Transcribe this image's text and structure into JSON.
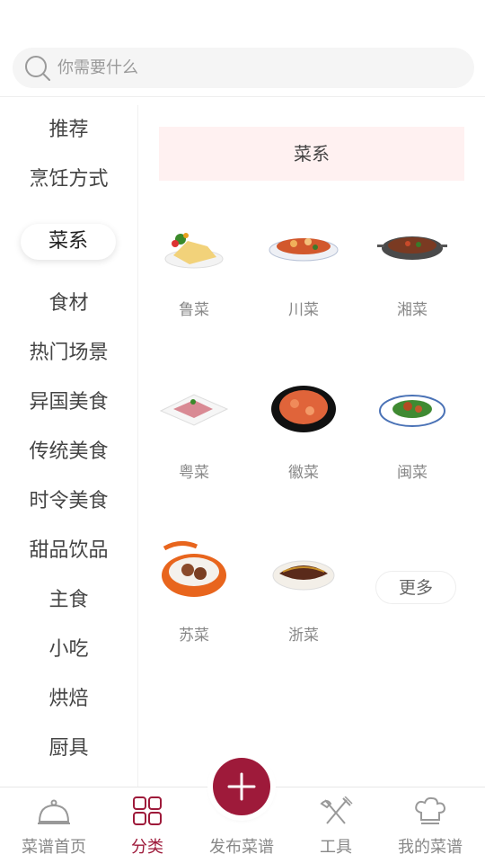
{
  "search": {
    "placeholder": "你需要什么"
  },
  "sidebar": {
    "items": [
      {
        "label": "推荐"
      },
      {
        "label": "烹饪方式"
      },
      {
        "label": "菜系",
        "active": true
      },
      {
        "label": "食材"
      },
      {
        "label": "热门场景"
      },
      {
        "label": "异国美食"
      },
      {
        "label": "传统美食"
      },
      {
        "label": "时令美食"
      },
      {
        "label": "甜品饮品"
      },
      {
        "label": "主食"
      },
      {
        "label": "小吃"
      },
      {
        "label": "烘焙"
      },
      {
        "label": "厨具"
      }
    ]
  },
  "section": {
    "title": "菜系"
  },
  "cuisines": [
    {
      "label": "鲁菜",
      "icon": "lu-cuisine-dish-image"
    },
    {
      "label": "川菜",
      "icon": "chuan-cuisine-dish-image"
    },
    {
      "label": "湘菜",
      "icon": "xiang-cuisine-dish-image"
    },
    {
      "label": "粤菜",
      "icon": "yue-cuisine-dish-image"
    },
    {
      "label": "徽菜",
      "icon": "hui-cuisine-dish-image"
    },
    {
      "label": "闽菜",
      "icon": "min-cuisine-dish-image"
    },
    {
      "label": "苏菜",
      "icon": "su-cuisine-dish-image"
    },
    {
      "label": "浙菜",
      "icon": "zhe-cuisine-dish-image"
    }
  ],
  "more_label": "更多",
  "bottom_nav": {
    "items": [
      {
        "label": "菜谱首页",
        "icon": "cloche-icon"
      },
      {
        "label": "分类",
        "icon": "grid-icon",
        "active": true
      },
      {
        "label": "发布菜谱",
        "icon": "plus-icon"
      },
      {
        "label": "工具",
        "icon": "fork-knife-icon"
      },
      {
        "label": "我的菜谱",
        "icon": "chef-hat-icon"
      }
    ]
  },
  "colors": {
    "accent": "#9e1a3a",
    "header_bg": "#fff1f1"
  }
}
